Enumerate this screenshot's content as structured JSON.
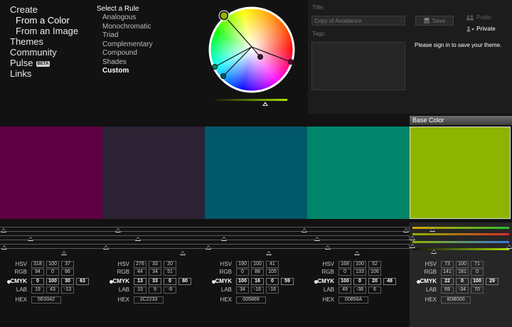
{
  "nav": {
    "create": "Create",
    "from_a_color": "From a Color",
    "from_an_image": "From an Image",
    "themes": "Themes",
    "community": "Community",
    "pulse": "Pulse",
    "beta": "BETA",
    "links": "Links"
  },
  "rules": {
    "title": "Select a Rule",
    "items": [
      "Analogous",
      "Monochromatic",
      "Triad",
      "Complementary",
      "Compound",
      "Shades",
      "Custom"
    ],
    "selected": "Custom"
  },
  "save_panel": {
    "title_label": "Title:",
    "title_value": "Copy of Avoidance",
    "save_label": "Save",
    "tags_label": "Tags:",
    "public_label": "Public",
    "private_label": "Private",
    "visibility": "Private",
    "signin_message": "Please sign in to save your theme."
  },
  "base_color_label": "Base Color",
  "labels": {
    "hsv": "HSV",
    "rgb": "RGB",
    "cmyk": "CMYK",
    "lab": "LAB",
    "hex": "HEX"
  },
  "swatches": [
    {
      "color": "#5E0042",
      "hsv": [
        "318",
        "100",
        "37"
      ],
      "rgb": [
        "94",
        "0",
        "66"
      ],
      "cmyk": [
        "0",
        "100",
        "30",
        "63"
      ],
      "lab": [
        "19",
        "43",
        "-13"
      ],
      "hex": "5E0042"
    },
    {
      "color": "#2C2233",
      "hsv": [
        "276",
        "33",
        "20"
      ],
      "rgb": [
        "44",
        "34",
        "51"
      ],
      "cmyk": [
        "13",
        "33",
        "0",
        "80"
      ],
      "lab": [
        "15",
        "9",
        "-9"
      ],
      "hex": "2C2233"
    },
    {
      "color": "#005869",
      "hsv": [
        "190",
        "100",
        "41"
      ],
      "rgb": [
        "0",
        "88",
        "105"
      ],
      "cmyk": [
        "100",
        "16",
        "0",
        "59"
      ],
      "lab": [
        "34",
        "-16",
        "-16"
      ],
      "hex": "005869"
    },
    {
      "color": "#00856A",
      "hsv": [
        "168",
        "100",
        "52"
      ],
      "rgb": [
        "0",
        "133",
        "106"
      ],
      "cmyk": [
        "100",
        "0",
        "20",
        "48"
      ],
      "lab": [
        "49",
        "-38",
        "6"
      ],
      "hex": "00856A"
    },
    {
      "color": "#8DB500",
      "hsv": [
        "73",
        "100",
        "71"
      ],
      "rgb": [
        "141",
        "181",
        "0"
      ],
      "cmyk": [
        "22",
        "0",
        "100",
        "29"
      ],
      "lab": [
        "69",
        "-34",
        "70"
      ],
      "hex": "8DB500"
    }
  ],
  "base_index": 4,
  "colors": {
    "background": "#121212",
    "panel": "#1c1c1c",
    "base_column": "#262626",
    "slider_red": "#e0282a",
    "slider_green": "#2ebd2e",
    "slider_blue": "#3a78d8"
  },
  "icons": {
    "save": "floppy-disk-icon",
    "public": "people-icon",
    "private": "person-icon",
    "selected_channel": "radio-dot-icon",
    "slider_handle": "triangle-up-icon"
  }
}
